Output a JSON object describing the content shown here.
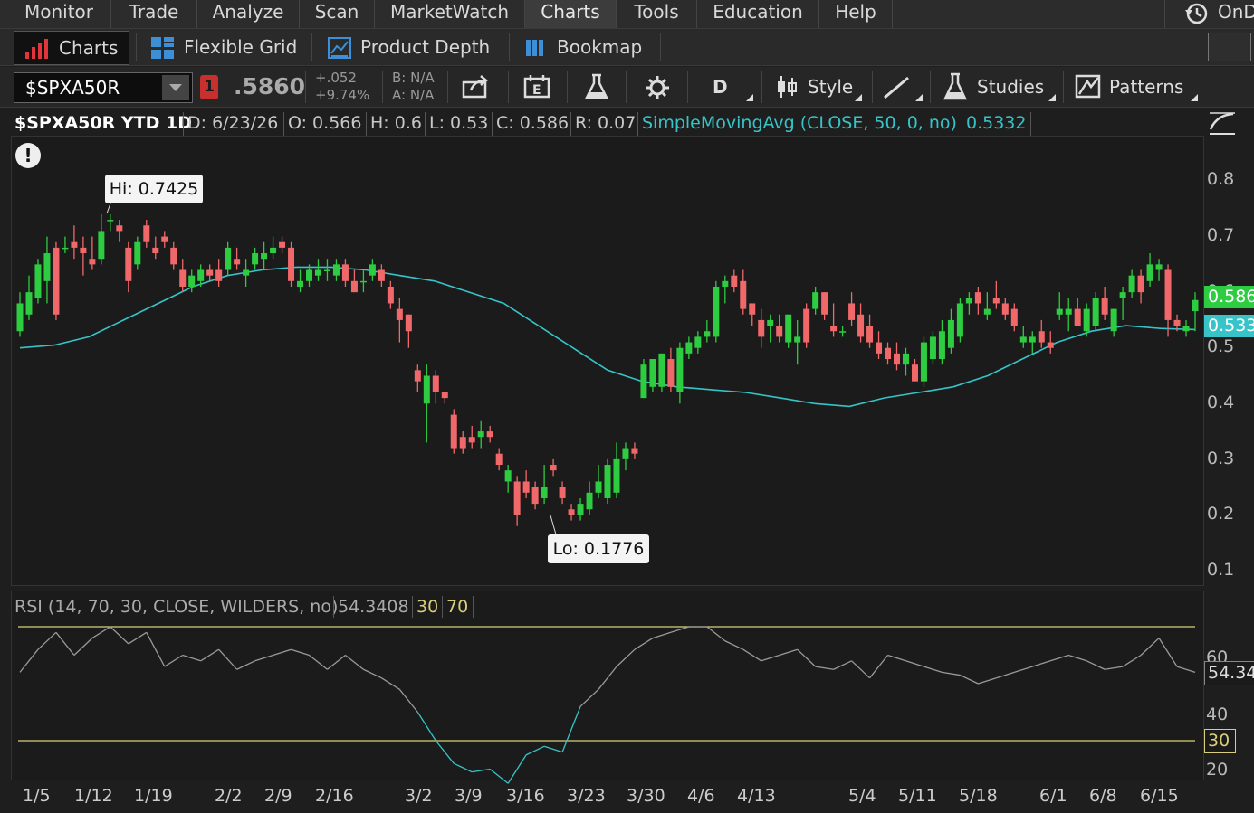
{
  "menu": {
    "items": [
      "Monitor",
      "Trade",
      "Analyze",
      "Scan",
      "MarketWatch",
      "Charts",
      "Tools",
      "Education",
      "Help"
    ],
    "ondemand_label": "OnD"
  },
  "subtabs": [
    "Charts",
    "Flexible Grid",
    "Product Depth",
    "Bookmap"
  ],
  "toolbar": {
    "symbol": "$SPXA50R",
    "alert_badge": "1",
    "last_price": ".5860",
    "change_abs": "+.052",
    "change_pct": "+9.74%",
    "bid": "B: N/A",
    "ask": "A: N/A",
    "aggregation": "D",
    "style_label": "Style",
    "studies_label": "Studies",
    "patterns_label": "Patterns"
  },
  "infobar": {
    "title": "$SPXA50R YTD 1D",
    "date": "D: 6/23/26",
    "open": "O: 0.566",
    "high": "H: 0.6",
    "low": "L: 0.53",
    "close": "C: 0.586",
    "range": "R: 0.07",
    "sma_label": "SimpleMovingAvg (CLOSE, 50, 0, no)",
    "sma_value": "0.5332"
  },
  "annotations": {
    "hi": "Hi: 0.7425",
    "lo": "Lo: 0.1776",
    "alert_icon": "!"
  },
  "price_markers": {
    "last": "0.586",
    "sma": "0.533"
  },
  "rsi": {
    "label": "RSI (14, 70, 30, CLOSE, WILDERS, no)",
    "value": "54.3408",
    "oversold": "30",
    "overbought": "70",
    "marker_value": "54.34",
    "marker_30": "30"
  },
  "colors": {
    "up": "#2ecc40",
    "down": "#f0686a",
    "sma": "#36c4c8",
    "rsi_line": "#9a9a9a",
    "rsi_low": "#36c4c8",
    "rsi_bands": "#d8cf7a"
  },
  "chart_data": {
    "type": "candlestick",
    "title": "$SPXA50R YTD 1D",
    "y_ticks": [
      "0.8",
      "0.7",
      "0.6",
      "0.5",
      "0.4",
      "0.3",
      "0.2",
      "0.1"
    ],
    "x_ticks": [
      "1/5",
      "1/12",
      "1/19",
      "2/2",
      "2/9",
      "2/16",
      "3/2",
      "3/9",
      "3/16",
      "3/23",
      "3/30",
      "4/6",
      "4/13",
      "5/4",
      "5/11",
      "5/18",
      "6/1",
      "6/8",
      "6/15"
    ],
    "ylim": [
      0.07,
      0.87
    ],
    "hi": 0.7425,
    "lo": 0.1776,
    "candles": [
      {
        "o": 0.53,
        "h": 0.6,
        "l": 0.52,
        "c": 0.58
      },
      {
        "o": 0.56,
        "h": 0.63,
        "l": 0.55,
        "c": 0.6
      },
      {
        "o": 0.59,
        "h": 0.66,
        "l": 0.58,
        "c": 0.65
      },
      {
        "o": 0.62,
        "h": 0.7,
        "l": 0.58,
        "c": 0.67
      },
      {
        "o": 0.68,
        "h": 0.69,
        "l": 0.55,
        "c": 0.56
      },
      {
        "o": 0.68,
        "h": 0.7,
        "l": 0.67,
        "c": 0.68
      },
      {
        "o": 0.69,
        "h": 0.72,
        "l": 0.66,
        "c": 0.68
      },
      {
        "o": 0.68,
        "h": 0.7,
        "l": 0.63,
        "c": 0.67
      },
      {
        "o": 0.66,
        "h": 0.7,
        "l": 0.64,
        "c": 0.65
      },
      {
        "o": 0.66,
        "h": 0.74,
        "l": 0.65,
        "c": 0.71
      },
      {
        "o": 0.73,
        "h": 0.74,
        "l": 0.71,
        "c": 0.73
      },
      {
        "o": 0.72,
        "h": 0.73,
        "l": 0.69,
        "c": 0.71
      },
      {
        "o": 0.68,
        "h": 0.69,
        "l": 0.6,
        "c": 0.62
      },
      {
        "o": 0.65,
        "h": 0.7,
        "l": 0.64,
        "c": 0.69
      },
      {
        "o": 0.72,
        "h": 0.73,
        "l": 0.68,
        "c": 0.69
      },
      {
        "o": 0.68,
        "h": 0.7,
        "l": 0.66,
        "c": 0.67
      },
      {
        "o": 0.7,
        "h": 0.71,
        "l": 0.68,
        "c": 0.69
      },
      {
        "o": 0.68,
        "h": 0.69,
        "l": 0.64,
        "c": 0.65
      },
      {
        "o": 0.64,
        "h": 0.66,
        "l": 0.6,
        "c": 0.61
      },
      {
        "o": 0.61,
        "h": 0.64,
        "l": 0.6,
        "c": 0.63
      },
      {
        "o": 0.62,
        "h": 0.65,
        "l": 0.61,
        "c": 0.64
      },
      {
        "o": 0.64,
        "h": 0.65,
        "l": 0.62,
        "c": 0.63
      },
      {
        "o": 0.64,
        "h": 0.66,
        "l": 0.61,
        "c": 0.62
      },
      {
        "o": 0.64,
        "h": 0.69,
        "l": 0.63,
        "c": 0.68
      },
      {
        "o": 0.66,
        "h": 0.68,
        "l": 0.64,
        "c": 0.65
      },
      {
        "o": 0.63,
        "h": 0.66,
        "l": 0.61,
        "c": 0.64
      },
      {
        "o": 0.65,
        "h": 0.68,
        "l": 0.64,
        "c": 0.67
      },
      {
        "o": 0.66,
        "h": 0.69,
        "l": 0.64,
        "c": 0.67
      },
      {
        "o": 0.67,
        "h": 0.7,
        "l": 0.66,
        "c": 0.68
      },
      {
        "o": 0.69,
        "h": 0.7,
        "l": 0.67,
        "c": 0.68
      },
      {
        "o": 0.68,
        "h": 0.69,
        "l": 0.61,
        "c": 0.62
      },
      {
        "o": 0.61,
        "h": 0.64,
        "l": 0.6,
        "c": 0.62
      },
      {
        "o": 0.62,
        "h": 0.65,
        "l": 0.61,
        "c": 0.64
      },
      {
        "o": 0.63,
        "h": 0.66,
        "l": 0.62,
        "c": 0.64
      },
      {
        "o": 0.64,
        "h": 0.66,
        "l": 0.62,
        "c": 0.64
      },
      {
        "o": 0.63,
        "h": 0.66,
        "l": 0.62,
        "c": 0.65
      },
      {
        "o": 0.65,
        "h": 0.66,
        "l": 0.61,
        "c": 0.62
      },
      {
        "o": 0.62,
        "h": 0.64,
        "l": 0.6,
        "c": 0.6
      },
      {
        "o": 0.62,
        "h": 0.64,
        "l": 0.6,
        "c": 0.62
      },
      {
        "o": 0.63,
        "h": 0.66,
        "l": 0.62,
        "c": 0.65
      },
      {
        "o": 0.64,
        "h": 0.65,
        "l": 0.61,
        "c": 0.62
      },
      {
        "o": 0.61,
        "h": 0.62,
        "l": 0.57,
        "c": 0.58
      },
      {
        "o": 0.57,
        "h": 0.59,
        "l": 0.51,
        "c": 0.55
      },
      {
        "o": 0.56,
        "h": 0.56,
        "l": 0.5,
        "c": 0.53
      },
      {
        "o": 0.46,
        "h": 0.47,
        "l": 0.42,
        "c": 0.44
      },
      {
        "o": 0.4,
        "h": 0.47,
        "l": 0.33,
        "c": 0.45
      },
      {
        "o": 0.45,
        "h": 0.46,
        "l": 0.4,
        "c": 0.42
      },
      {
        "o": 0.42,
        "h": 0.42,
        "l": 0.4,
        "c": 0.41
      },
      {
        "o": 0.38,
        "h": 0.39,
        "l": 0.31,
        "c": 0.32
      },
      {
        "o": 0.34,
        "h": 0.35,
        "l": 0.31,
        "c": 0.32
      },
      {
        "o": 0.34,
        "h": 0.36,
        "l": 0.32,
        "c": 0.33
      },
      {
        "o": 0.34,
        "h": 0.37,
        "l": 0.32,
        "c": 0.35
      },
      {
        "o": 0.35,
        "h": 0.36,
        "l": 0.33,
        "c": 0.34
      },
      {
        "o": 0.31,
        "h": 0.32,
        "l": 0.28,
        "c": 0.29
      },
      {
        "o": 0.26,
        "h": 0.29,
        "l": 0.24,
        "c": 0.28
      },
      {
        "o": 0.26,
        "h": 0.27,
        "l": 0.18,
        "c": 0.2
      },
      {
        "o": 0.26,
        "h": 0.28,
        "l": 0.23,
        "c": 0.24
      },
      {
        "o": 0.25,
        "h": 0.26,
        "l": 0.21,
        "c": 0.22
      },
      {
        "o": 0.23,
        "h": 0.29,
        "l": 0.22,
        "c": 0.25
      },
      {
        "o": 0.29,
        "h": 0.3,
        "l": 0.27,
        "c": 0.28
      },
      {
        "o": 0.25,
        "h": 0.26,
        "l": 0.22,
        "c": 0.23
      },
      {
        "o": 0.21,
        "h": 0.22,
        "l": 0.19,
        "c": 0.2
      },
      {
        "o": 0.2,
        "h": 0.23,
        "l": 0.19,
        "c": 0.22
      },
      {
        "o": 0.21,
        "h": 0.26,
        "l": 0.2,
        "c": 0.24
      },
      {
        "o": 0.24,
        "h": 0.29,
        "l": 0.23,
        "c": 0.26
      },
      {
        "o": 0.23,
        "h": 0.3,
        "l": 0.22,
        "c": 0.29
      },
      {
        "o": 0.24,
        "h": 0.33,
        "l": 0.23,
        "c": 0.3
      },
      {
        "o": 0.3,
        "h": 0.33,
        "l": 0.28,
        "c": 0.32
      },
      {
        "o": 0.32,
        "h": 0.33,
        "l": 0.3,
        "c": 0.31
      },
      {
        "o": 0.41,
        "h": 0.48,
        "l": 0.41,
        "c": 0.47
      },
      {
        "o": 0.43,
        "h": 0.48,
        "l": 0.42,
        "c": 0.48
      },
      {
        "o": 0.43,
        "h": 0.49,
        "l": 0.42,
        "c": 0.49
      },
      {
        "o": 0.48,
        "h": 0.5,
        "l": 0.42,
        "c": 0.43
      },
      {
        "o": 0.42,
        "h": 0.51,
        "l": 0.4,
        "c": 0.5
      },
      {
        "o": 0.49,
        "h": 0.52,
        "l": 0.48,
        "c": 0.51
      },
      {
        "o": 0.5,
        "h": 0.53,
        "l": 0.49,
        "c": 0.52
      },
      {
        "o": 0.52,
        "h": 0.55,
        "l": 0.51,
        "c": 0.53
      },
      {
        "o": 0.52,
        "h": 0.62,
        "l": 0.51,
        "c": 0.61
      },
      {
        "o": 0.61,
        "h": 0.63,
        "l": 0.58,
        "c": 0.62
      },
      {
        "o": 0.63,
        "h": 0.64,
        "l": 0.6,
        "c": 0.61
      },
      {
        "o": 0.62,
        "h": 0.64,
        "l": 0.56,
        "c": 0.57
      },
      {
        "o": 0.58,
        "h": 0.58,
        "l": 0.54,
        "c": 0.56
      },
      {
        "o": 0.55,
        "h": 0.57,
        "l": 0.5,
        "c": 0.52
      },
      {
        "o": 0.54,
        "h": 0.56,
        "l": 0.51,
        "c": 0.55
      },
      {
        "o": 0.54,
        "h": 0.56,
        "l": 0.51,
        "c": 0.52
      },
      {
        "o": 0.51,
        "h": 0.56,
        "l": 0.5,
        "c": 0.56
      },
      {
        "o": 0.51,
        "h": 0.55,
        "l": 0.47,
        "c": 0.52
      },
      {
        "o": 0.57,
        "h": 0.58,
        "l": 0.5,
        "c": 0.51
      },
      {
        "o": 0.57,
        "h": 0.61,
        "l": 0.56,
        "c": 0.6
      },
      {
        "o": 0.6,
        "h": 0.6,
        "l": 0.55,
        "c": 0.56
      },
      {
        "o": 0.54,
        "h": 0.58,
        "l": 0.52,
        "c": 0.53
      },
      {
        "o": 0.53,
        "h": 0.54,
        "l": 0.52,
        "c": 0.53
      },
      {
        "o": 0.58,
        "h": 0.6,
        "l": 0.54,
        "c": 0.55
      },
      {
        "o": 0.56,
        "h": 0.58,
        "l": 0.51,
        "c": 0.52
      },
      {
        "o": 0.54,
        "h": 0.56,
        "l": 0.5,
        "c": 0.51
      },
      {
        "o": 0.51,
        "h": 0.53,
        "l": 0.48,
        "c": 0.49
      },
      {
        "o": 0.5,
        "h": 0.51,
        "l": 0.47,
        "c": 0.48
      },
      {
        "o": 0.49,
        "h": 0.51,
        "l": 0.46,
        "c": 0.47
      },
      {
        "o": 0.47,
        "h": 0.5,
        "l": 0.45,
        "c": 0.49
      },
      {
        "o": 0.47,
        "h": 0.48,
        "l": 0.44,
        "c": 0.44
      },
      {
        "o": 0.44,
        "h": 0.52,
        "l": 0.43,
        "c": 0.51
      },
      {
        "o": 0.48,
        "h": 0.53,
        "l": 0.47,
        "c": 0.52
      },
      {
        "o": 0.48,
        "h": 0.55,
        "l": 0.47,
        "c": 0.53
      },
      {
        "o": 0.5,
        "h": 0.57,
        "l": 0.49,
        "c": 0.55
      },
      {
        "o": 0.52,
        "h": 0.59,
        "l": 0.51,
        "c": 0.58
      },
      {
        "o": 0.58,
        "h": 0.6,
        "l": 0.56,
        "c": 0.59
      },
      {
        "o": 0.6,
        "h": 0.61,
        "l": 0.56,
        "c": 0.58
      },
      {
        "o": 0.56,
        "h": 0.6,
        "l": 0.55,
        "c": 0.57
      },
      {
        "o": 0.59,
        "h": 0.62,
        "l": 0.57,
        "c": 0.58
      },
      {
        "o": 0.58,
        "h": 0.59,
        "l": 0.55,
        "c": 0.56
      },
      {
        "o": 0.57,
        "h": 0.58,
        "l": 0.53,
        "c": 0.54
      },
      {
        "o": 0.51,
        "h": 0.54,
        "l": 0.5,
        "c": 0.52
      },
      {
        "o": 0.51,
        "h": 0.53,
        "l": 0.49,
        "c": 0.52
      },
      {
        "o": 0.53,
        "h": 0.55,
        "l": 0.5,
        "c": 0.51
      },
      {
        "o": 0.51,
        "h": 0.53,
        "l": 0.49,
        "c": 0.5
      },
      {
        "o": 0.56,
        "h": 0.6,
        "l": 0.55,
        "c": 0.57
      },
      {
        "o": 0.56,
        "h": 0.59,
        "l": 0.53,
        "c": 0.57
      },
      {
        "o": 0.57,
        "h": 0.59,
        "l": 0.54,
        "c": 0.54
      },
      {
        "o": 0.53,
        "h": 0.58,
        "l": 0.52,
        "c": 0.57
      },
      {
        "o": 0.54,
        "h": 0.6,
        "l": 0.53,
        "c": 0.59
      },
      {
        "o": 0.59,
        "h": 0.61,
        "l": 0.55,
        "c": 0.56
      },
      {
        "o": 0.53,
        "h": 0.57,
        "l": 0.52,
        "c": 0.57
      },
      {
        "o": 0.59,
        "h": 0.61,
        "l": 0.55,
        "c": 0.6
      },
      {
        "o": 0.6,
        "h": 0.64,
        "l": 0.59,
        "c": 0.63
      },
      {
        "o": 0.63,
        "h": 0.64,
        "l": 0.58,
        "c": 0.6
      },
      {
        "o": 0.62,
        "h": 0.67,
        "l": 0.61,
        "c": 0.65
      },
      {
        "o": 0.64,
        "h": 0.66,
        "l": 0.62,
        "c": 0.65
      },
      {
        "o": 0.64,
        "h": 0.65,
        "l": 0.52,
        "c": 0.55
      },
      {
        "o": 0.55,
        "h": 0.56,
        "l": 0.53,
        "c": 0.54
      },
      {
        "o": 0.53,
        "h": 0.55,
        "l": 0.52,
        "c": 0.54
      },
      {
        "o": 0.566,
        "h": 0.6,
        "l": 0.53,
        "c": 0.586
      }
    ],
    "sma": [
      0.5,
      0.505,
      0.52,
      0.55,
      0.58,
      0.61,
      0.63,
      0.64,
      0.645,
      0.645,
      0.64,
      0.63,
      0.62,
      0.6,
      0.58,
      0.54,
      0.5,
      0.46,
      0.44,
      0.43,
      0.425,
      0.42,
      0.41,
      0.4,
      0.395,
      0.41,
      0.42,
      0.43,
      0.45,
      0.48,
      0.51,
      0.53,
      0.54,
      0.535,
      0.533
    ],
    "rsi": [
      54,
      62,
      68,
      60,
      66,
      70,
      64,
      68,
      56,
      60,
      58,
      62,
      55,
      58,
      60,
      62,
      60,
      55,
      60,
      55,
      52,
      48,
      40,
      30,
      22,
      19,
      20,
      15,
      25,
      28,
      26,
      42,
      48,
      56,
      62,
      66,
      68,
      70,
      70,
      65,
      62,
      58,
      60,
      62,
      56,
      55,
      58,
      52,
      60,
      58,
      56,
      54,
      53,
      50,
      52,
      54,
      56,
      58,
      60,
      58,
      55,
      56,
      60,
      66,
      56,
      54
    ],
    "rsi_levels": [
      30,
      70
    ]
  }
}
